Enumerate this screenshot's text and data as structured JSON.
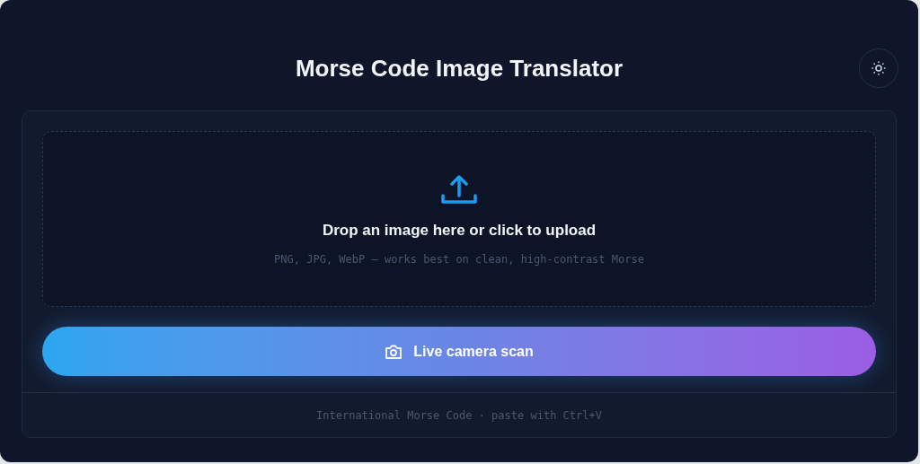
{
  "title": "Morse Code Image Translator",
  "dropzone": {
    "heading": "Drop an image here or click to upload",
    "hint": "PNG, JPG, WebP — works best on clean, high-contrast Morse"
  },
  "camera_button": {
    "label": "Live camera scan"
  },
  "footer": "International Morse Code · paste with Ctrl+V"
}
